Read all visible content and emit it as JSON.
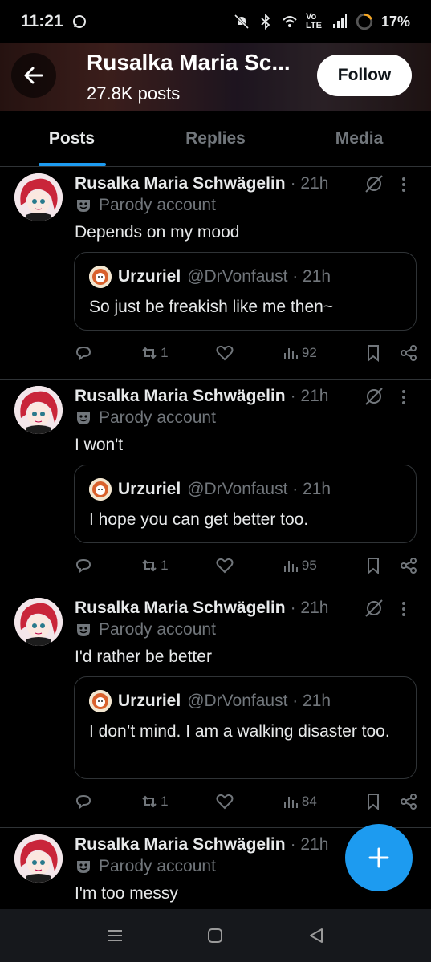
{
  "status": {
    "time": "11:21",
    "battery": "17%",
    "network": "Vo LTE"
  },
  "header": {
    "title": "Rusalka Maria Sc...",
    "posts_count": "27.8K posts",
    "follow_label": "Follow"
  },
  "tabs": [
    {
      "label": "Posts",
      "active": true
    },
    {
      "label": "Replies",
      "active": false
    },
    {
      "label": "Media",
      "active": false
    }
  ],
  "posts": [
    {
      "author": "Rusalka Maria Schwägelin",
      "time": "· 21h",
      "badge": "Parody account",
      "text": "Depends on my mood",
      "quote": {
        "name": "Urzuriel",
        "handle": "@DrVonfaust · 21h",
        "text": "So just be freakish like me then~"
      },
      "reposts": "1",
      "views": "92"
    },
    {
      "author": "Rusalka Maria Schwägelin",
      "time": "· 21h",
      "badge": "Parody account",
      "text": "I won't",
      "quote": {
        "name": "Urzuriel",
        "handle": "@DrVonfaust · 21h",
        "text": "I hope you can get better too."
      },
      "reposts": "1",
      "views": "95"
    },
    {
      "author": "Rusalka Maria Schwägelin",
      "time": "· 21h",
      "badge": "Parody account",
      "text": "I'd rather be better",
      "quote": {
        "name": "Urzuriel",
        "handle": "@DrVonfaust · 21h",
        "text": "I don’t mind. I am a walking disaster too."
      },
      "reposts": "1",
      "views": "84"
    },
    {
      "author": "Rusalka Maria Schwägelin",
      "time": "· 21h",
      "badge": "Parody account",
      "text": "I'm too messy"
    }
  ],
  "icons": {
    "back": "arrow-left-icon",
    "grok": "grok-icon",
    "more": "more-vertical-icon",
    "reply": "reply-icon",
    "repost": "repost-icon",
    "like": "heart-icon",
    "views": "views-icon",
    "bookmark": "bookmark-icon",
    "share": "share-icon",
    "compose": "plus-icon"
  },
  "colors": {
    "accent": "#1d9bf0",
    "text": "#e7e9ea",
    "muted": "#71767b",
    "border": "#2f3336",
    "background": "#000000"
  }
}
